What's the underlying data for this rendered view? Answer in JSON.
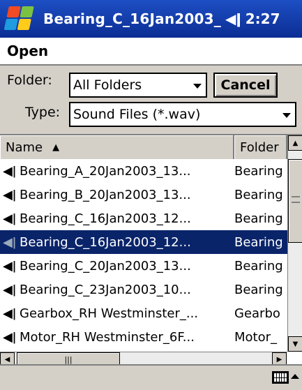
{
  "titlebar": {
    "title": "Bearing_C_16Jan2003_",
    "speaker": "◀ǀ",
    "time": "2:27"
  },
  "menu": {
    "open_label": "Open"
  },
  "folder": {
    "label": "Folder:",
    "value": "All Folders"
  },
  "type": {
    "label": "Type:",
    "value": "Sound Files (*.wav)"
  },
  "cancel_label": "Cancel",
  "list": {
    "columns": {
      "name": "Name",
      "folder": "Folder"
    },
    "rows": [
      {
        "name": "Bearing_A_20Jan2003_13...",
        "folder": "Bearing"
      },
      {
        "name": "Bearing_B_20Jan2003_13...",
        "folder": "Bearing"
      },
      {
        "name": "Bearing_C_16Jan2003_12...",
        "folder": "Bearing"
      },
      {
        "name": "Bearing_C_16Jan2003_12...",
        "folder": "Bearing"
      },
      {
        "name": "Bearing_C_20Jan2003_13...",
        "folder": "Bearing"
      },
      {
        "name": "Bearing_C_23Jan2003_10...",
        "folder": "Bearing"
      },
      {
        "name": "Gearbox_RH Westminster_...",
        "folder": "Gearbo"
      },
      {
        "name": "Motor_RH Westminster_6F...",
        "folder": "Motor_"
      }
    ],
    "selected_index": 3
  },
  "colors": {
    "titlebar": "#1d4fc4",
    "selection": "#0a246a",
    "chrome": "#d4d0c8"
  }
}
